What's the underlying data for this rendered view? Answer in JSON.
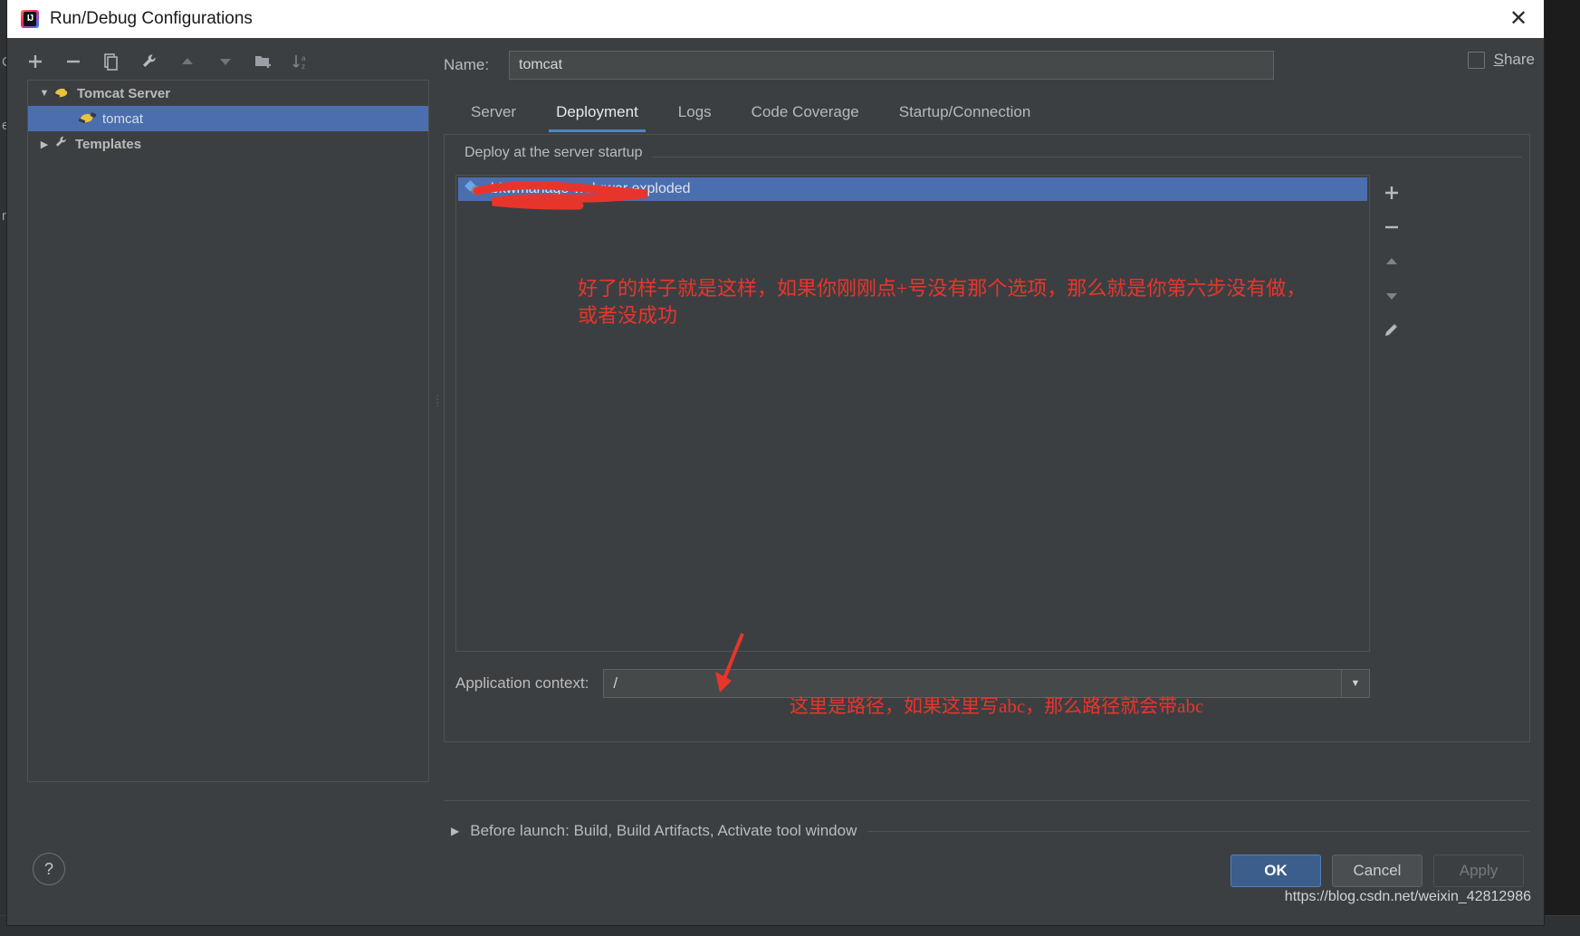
{
  "window": {
    "title": "Run/Debug Configurations",
    "app_icon": "intellij-idea-icon",
    "close_label": "✕"
  },
  "left_panel": {
    "toolbar": [
      {
        "name": "add-configuration-button",
        "glyph": "＋"
      },
      {
        "name": "remove-configuration-button",
        "glyph": "−"
      },
      {
        "name": "copy-configuration-button",
        "glyph": "⧉"
      },
      {
        "name": "edit-templates-button",
        "glyph": "ᵀ"
      },
      {
        "name": "move-up-button",
        "glyph": "▲"
      },
      {
        "name": "move-down-button",
        "glyph": "▼"
      },
      {
        "name": "move-into-folder-button",
        "glyph": "ᵀ"
      },
      {
        "name": "sort-configurations-button",
        "glyph": "↓"
      }
    ],
    "tree": [
      {
        "label": "Tomcat Server",
        "level": 1,
        "expanded": true,
        "twisty": "▼",
        "icon": "tomcat-icon",
        "selected": false
      },
      {
        "label": "tomcat",
        "level": 2,
        "expanded": false,
        "twisty": "",
        "icon": "tomcat-icon",
        "selected": true
      },
      {
        "label": "Templates",
        "level": 1,
        "expanded": false,
        "twisty": "▶",
        "icon": "wrench-icon",
        "selected": false
      }
    ]
  },
  "name_field": {
    "label": "Name:",
    "value": "tomcat",
    "placeholder": ""
  },
  "share": {
    "label_before": "S",
    "label_after": "hare",
    "checked": false
  },
  "tabs": [
    {
      "label": "Server",
      "active": false
    },
    {
      "label": "Deployment",
      "active": true
    },
    {
      "label": "Logs",
      "active": false
    },
    {
      "label": "Code Coverage",
      "active": false
    },
    {
      "label": "Startup/Connection",
      "active": false
    }
  ],
  "deployment": {
    "group_title": "Deploy at the server startup",
    "items": [
      {
        "label": "bkwmanage-web:war exploded",
        "icon": "artifact-icon",
        "selected": true
      }
    ],
    "side_actions": [
      {
        "name": "add-artifact-button",
        "glyph": "＋"
      },
      {
        "name": "remove-artifact-button",
        "glyph": "−"
      },
      {
        "name": "move-artifact-up-button",
        "glyph": "▲"
      },
      {
        "name": "move-artifact-down-button",
        "glyph": "▼"
      },
      {
        "name": "edit-artifact-button",
        "glyph": "✎"
      }
    ]
  },
  "application_context": {
    "label": "Application context:",
    "value": "/",
    "dropdown_glyph": "▼"
  },
  "before_launch": {
    "twisty": "▶",
    "label": "Before launch: Build, Build Artifacts, Activate tool window"
  },
  "footer": {
    "help_glyph": "?",
    "ok_label": "OK",
    "cancel_label": "Cancel",
    "apply_label": "Apply",
    "watermark": "https://blog.csdn.net/weixin_42812986"
  },
  "annotations": {
    "color": "#e8352c",
    "note_top_line1": "好了的样子就是这样，如果你刚刚点+号没有那个选项，那么就是你第六步没有做，",
    "note_top_line2": "或者没成功",
    "note_bottom": "这里是路径，如果这里写abc，那么路径就会带abc",
    "scribble_over_artifact": true,
    "arrow_to_application_context": true
  }
}
